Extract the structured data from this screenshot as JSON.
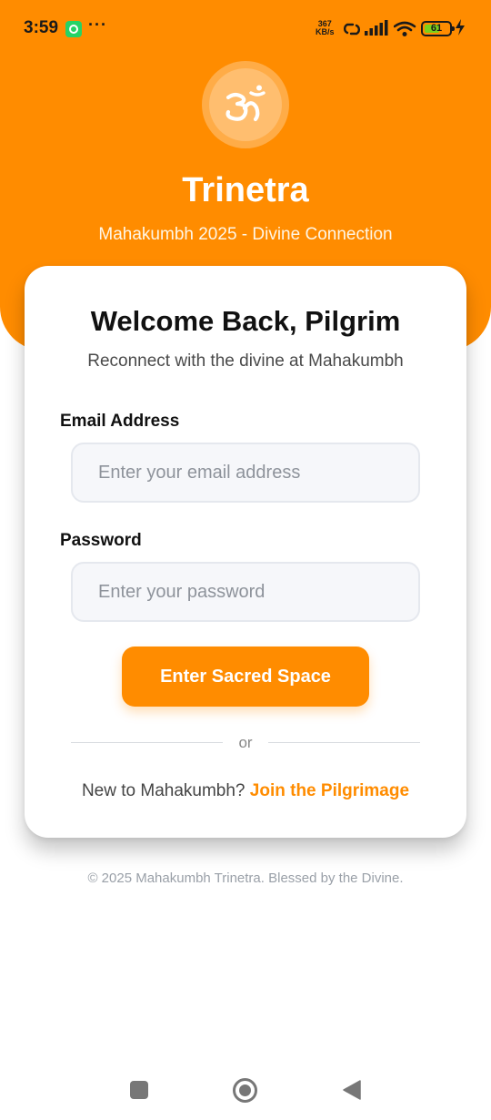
{
  "status_bar": {
    "time": "3:59",
    "more": "···",
    "net_speed_value": "367",
    "net_speed_unit": "KB/s",
    "battery": "61",
    "battery_level": 0.61
  },
  "header": {
    "logo_icon": "om-symbol-icon",
    "title": "Trinetra",
    "subtitle": "Mahakumbh 2025 - Divine Connection"
  },
  "login": {
    "title": "Welcome Back, Pilgrim",
    "subtitle": "Reconnect with the divine at Mahakumbh",
    "email_label": "Email Address",
    "email_placeholder": "Enter your email address",
    "password_label": "Password",
    "password_placeholder": "Enter your password",
    "submit_label": "Enter Sacred Space",
    "divider": "or",
    "signup_prompt": "New to Mahakumbh?",
    "signup_link": "Join the Pilgrimage"
  },
  "footer": {
    "copyright": "© 2025 Mahakumbh Trinetra. Blessed by the Divine."
  },
  "colors": {
    "accent": "#ff8c00",
    "battery_fill": "#7bd11b",
    "whatsapp": "#25d366"
  },
  "navigation": {
    "icons": [
      "recents-square-icon",
      "home-circle-icon",
      "back-triangle-icon"
    ]
  }
}
